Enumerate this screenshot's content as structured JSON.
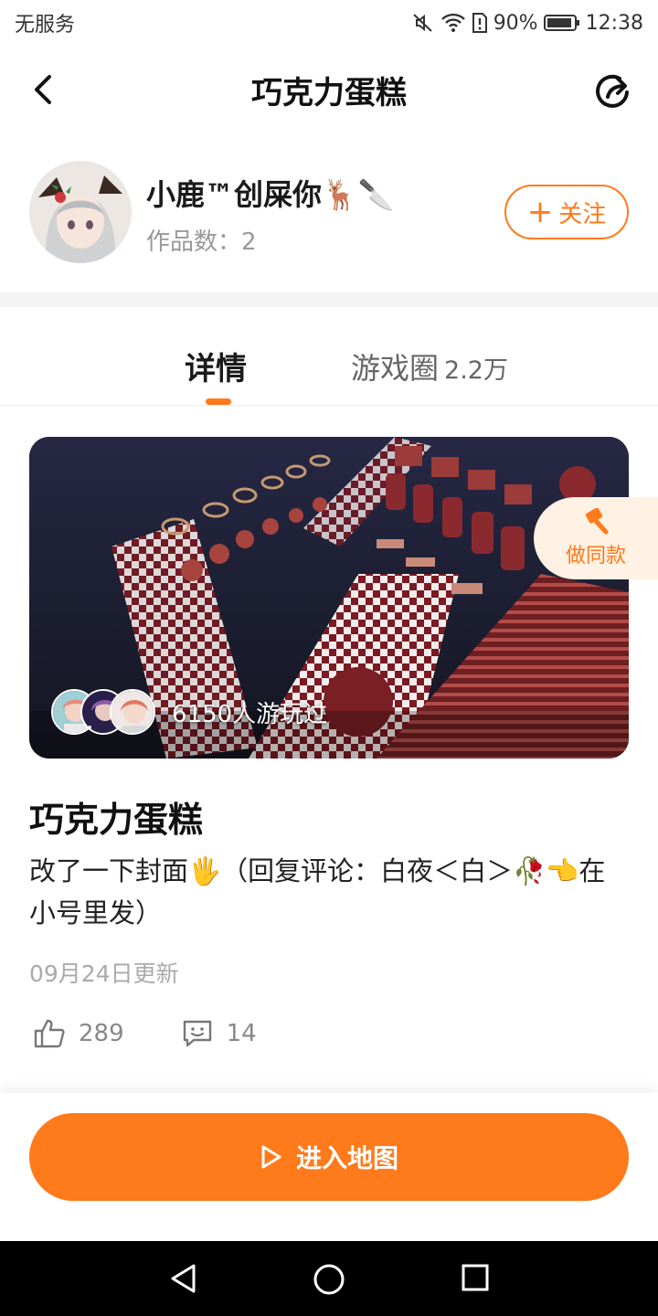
{
  "status_bar": {
    "carrier": "无服务",
    "battery": "90%",
    "time": "12:38",
    "icons": [
      "mute-icon",
      "wifi-icon",
      "sim-alert-icon",
      "battery-icon"
    ]
  },
  "nav": {
    "title": "巧克力蛋糕",
    "back_icon": "chevron-left-icon",
    "share_icon": "share-icon"
  },
  "author": {
    "name": "小鹿™创屎你🦌🔪",
    "works": "作品数：2",
    "follow_label": "关注"
  },
  "tabs": [
    {
      "label": "详情",
      "active": true
    },
    {
      "label": "游戏圈",
      "count": "2.2万",
      "active": false
    }
  ],
  "cover": {
    "players_text": "6150人游玩过"
  },
  "same_style": {
    "label": "做同款"
  },
  "work": {
    "title": "巧克力蛋糕",
    "description": "改了一下封面🖐（回复评论：白夜＜白＞🥀👈在小号里发）",
    "updated": "09月24日更新",
    "likes": "289",
    "comments": "14"
  },
  "enter_button": {
    "label": "进入地图"
  },
  "colors": {
    "accent": "#ff7a1a",
    "accent_light": "#fff1e3"
  }
}
